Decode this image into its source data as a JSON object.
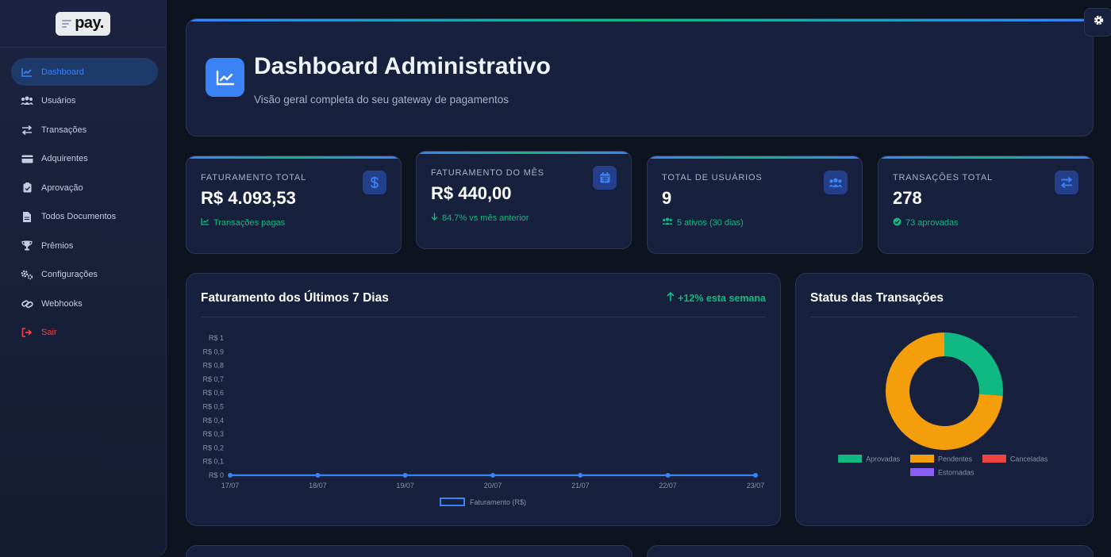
{
  "sidebar": {
    "logo_text": "pay.",
    "items": [
      {
        "label": "Dashboard",
        "icon": "chart-line-icon",
        "active": true
      },
      {
        "label": "Usuários",
        "icon": "users-icon"
      },
      {
        "label": "Transações",
        "icon": "arrows-exchange-icon"
      },
      {
        "label": "Adquirentes",
        "icon": "credit-card-icon"
      },
      {
        "label": "Aprovação",
        "icon": "clipboard-check-icon"
      },
      {
        "label": "Todos Documentos",
        "icon": "file-icon"
      },
      {
        "label": "Prêmios",
        "icon": "trophy-icon"
      },
      {
        "label": "Configurações",
        "icon": "cogs-icon"
      },
      {
        "label": "Webhooks",
        "icon": "link-icon"
      },
      {
        "label": "Sair",
        "icon": "sign-out-icon",
        "danger": true
      }
    ]
  },
  "header": {
    "title": "Dashboard Administrativo",
    "subtitle": "Visão geral completa do seu gateway de pagamentos"
  },
  "stats": [
    {
      "label": "FATURAMENTO TOTAL",
      "value": "R$ 4.093,53",
      "note": "Transações pagas",
      "icon": "dollar-icon",
      "note_icon": "chart-line-icon"
    },
    {
      "label": "FATURAMENTO DO MÊS",
      "value": "R$ 440,00",
      "note": "84.7% vs mês anterior",
      "icon": "calendar-icon",
      "note_icon": "arrow-down-icon"
    },
    {
      "label": "TOTAL DE USUÁRIOS",
      "value": "9",
      "note": "5 ativos (30 dias)",
      "icon": "users-icon",
      "note_icon": "users-icon"
    },
    {
      "label": "TRANSAÇÕES TOTAL",
      "value": "278",
      "note": "73 aprovadas",
      "icon": "arrows-exchange-icon",
      "note_icon": "check-circle-icon"
    }
  ],
  "colors": {
    "accent": "#3b82f6",
    "success": "#10b981",
    "warning": "#f59e0b",
    "danger": "#ef4444",
    "purple": "#8b5cf6"
  },
  "chart_data": [
    {
      "type": "line",
      "title": "Faturamento dos Últimos 7 Dias",
      "badge": "+12% esta semana",
      "x": [
        "17/07",
        "18/07",
        "19/07",
        "20/07",
        "21/07",
        "22/07",
        "23/07"
      ],
      "series": [
        {
          "name": "Faturamento (R$)",
          "values": [
            0,
            0,
            0,
            0,
            0,
            0,
            0
          ],
          "color": "#3b82f6"
        }
      ],
      "yticks": [
        "R$ 0",
        "R$ 0,1",
        "R$ 0,2",
        "R$ 0,3",
        "R$ 0,4",
        "R$ 0,5",
        "R$ 0,6",
        "R$ 0,7",
        "R$ 0,8",
        "R$ 0,9",
        "R$ 1"
      ],
      "ylim": [
        0,
        1
      ],
      "legend": "bottom",
      "grid": false
    },
    {
      "type": "pie",
      "title": "Status das Transações",
      "categories": [
        "Aprovadas",
        "Pendentes",
        "Canceladas",
        "Estornadas"
      ],
      "values": [
        73,
        205,
        0,
        0
      ],
      "colors": [
        "#10b981",
        "#f59e0b",
        "#ef4444",
        "#8b5cf6"
      ],
      "legend": "bottom"
    }
  ]
}
